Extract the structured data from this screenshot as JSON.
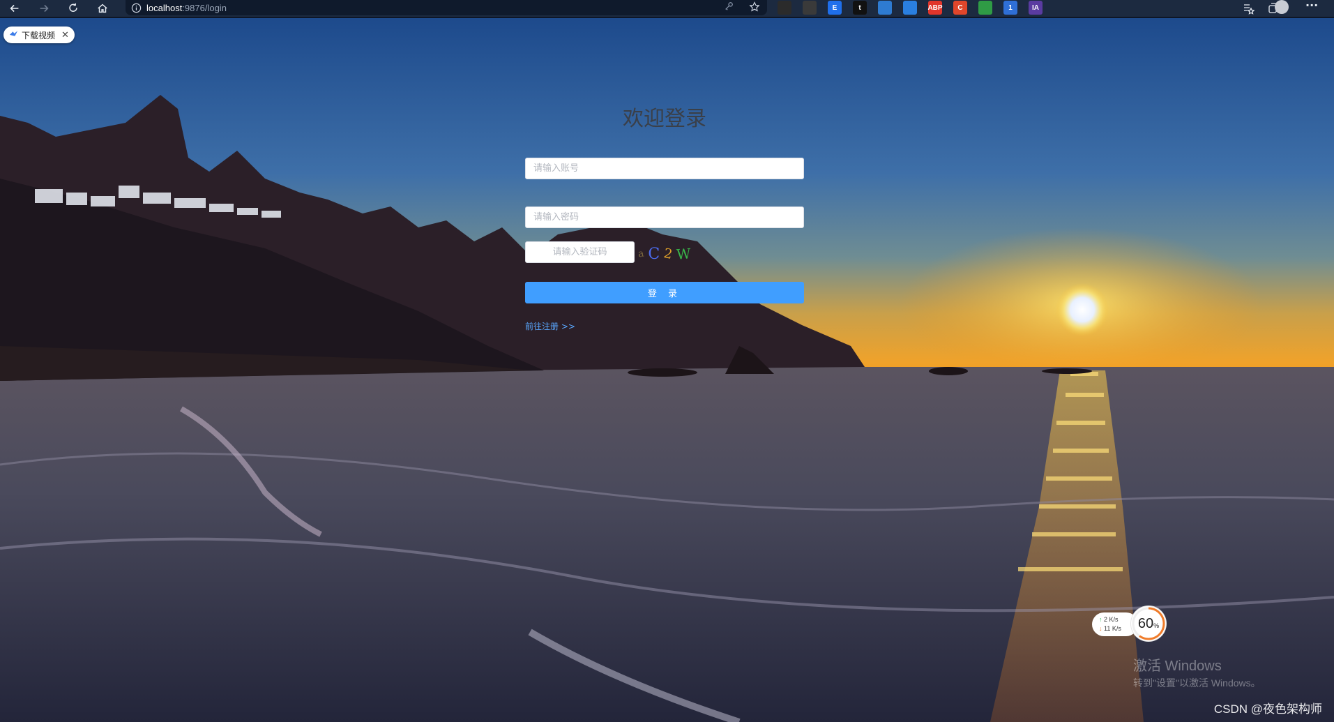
{
  "browser": {
    "url_host": "localhost",
    "url_path": ":9876/login"
  },
  "download_chip": {
    "label": "下载视频",
    "close": "✕"
  },
  "login": {
    "title": "欢迎登录",
    "username_placeholder": "请输入账号",
    "password_placeholder": "请输入密码",
    "captcha_placeholder": "请输入验证码",
    "captcha_chars": [
      {
        "char": "a",
        "color": "#7d6a3f"
      },
      {
        "char": "C",
        "color": "#4c6cf0"
      },
      {
        "char": "2",
        "color": "#e0a12a"
      },
      {
        "char": "W",
        "color": "#39b54a"
      }
    ],
    "submit_label": "登 录",
    "register_link": "前往注册 >>",
    "accent_color": "#409eff"
  },
  "net_speed": {
    "upload": "2  K/s",
    "download": "11  K/s",
    "percent": "60",
    "percent_unit": "%"
  },
  "windows_watermark": {
    "line1": "激活 Windows",
    "line2": "转到\"设置\"以激活 Windows。"
  },
  "csdn_watermark": "CSDN @夜色架构师",
  "extensions": [
    {
      "icon": "ext-mask-icon",
      "bg": "#2b2b2b",
      "label": ""
    },
    {
      "icon": "ext-square-icon",
      "bg": "#3a3a3a",
      "label": ""
    },
    {
      "icon": "ext-e-icon",
      "bg": "#1f6feb",
      "label": "E"
    },
    {
      "icon": "ext-black-icon",
      "bg": "#111111",
      "label": "t"
    },
    {
      "icon": "ext-blue-icon",
      "bg": "#2e7bd1",
      "label": ""
    },
    {
      "icon": "ext-check-icon",
      "bg": "#2a7fe0",
      "label": ""
    },
    {
      "icon": "ext-abp-icon",
      "bg": "#e0352b",
      "label": "ABP"
    },
    {
      "icon": "ext-c-icon",
      "bg": "#e0462b",
      "label": "C"
    },
    {
      "icon": "ext-green-icon",
      "bg": "#2f9b45",
      "label": ""
    },
    {
      "icon": "ext-download-icon",
      "bg": "#2f6fd6",
      "label": "1"
    },
    {
      "icon": "ext-ia-icon",
      "bg": "#5a3ba0",
      "label": "IA"
    }
  ]
}
